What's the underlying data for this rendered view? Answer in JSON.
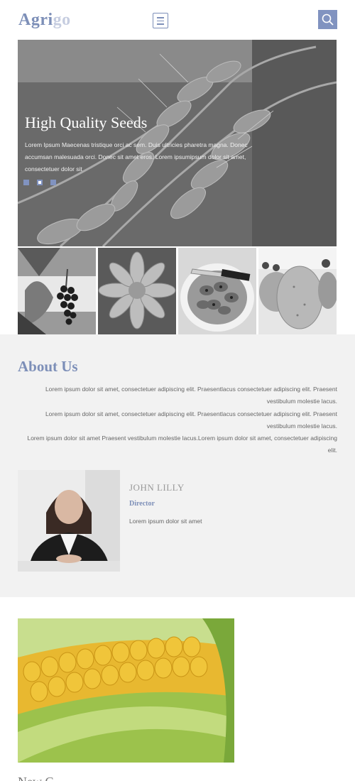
{
  "header": {
    "logo_part1": "Agri",
    "logo_part2": "go"
  },
  "hero": {
    "title": "High Quality Seeds",
    "text": "Lorem Ipsum Maecenas tristique orci ac sem. Duis ultricies pharetra magna. Donec accumsan malesuada orci. Donec sit amet eros. Lorem ipsumipsum dolor sit amet, consectetuer dolor sit",
    "active_slide": 2,
    "slide_count": 3
  },
  "about": {
    "title": "About Us",
    "paragraphs": [
      "Lorem ipsum dolor sit amet, consectetuer adipiscing elit. Praesentlacus consectetuer adipiscing elit. Praesent vestibulum molestie lacus.",
      "Lorem ipsum dolor sit amet, consectetuer adipiscing elit. Praesentlacus consectetuer adipiscing elit. Praesent vestibulum molestie lacus.",
      "Lorem ipsum dolor sit amet Praesent vestibulum molestie lacus.Lorem ipsum dolor sit amet, consectetuer adipiscing elit."
    ],
    "person": {
      "name": "JOHN LILLY",
      "role": "Director",
      "description": "Lorem ipsum dolor sit amet"
    }
  },
  "next_section": {
    "title_partial": "New C"
  },
  "colors": {
    "accent": "#7d8fb8",
    "accent_light": "#c6cde0",
    "search_bg": "#8193c0",
    "about_bg": "#f2f2f2"
  }
}
